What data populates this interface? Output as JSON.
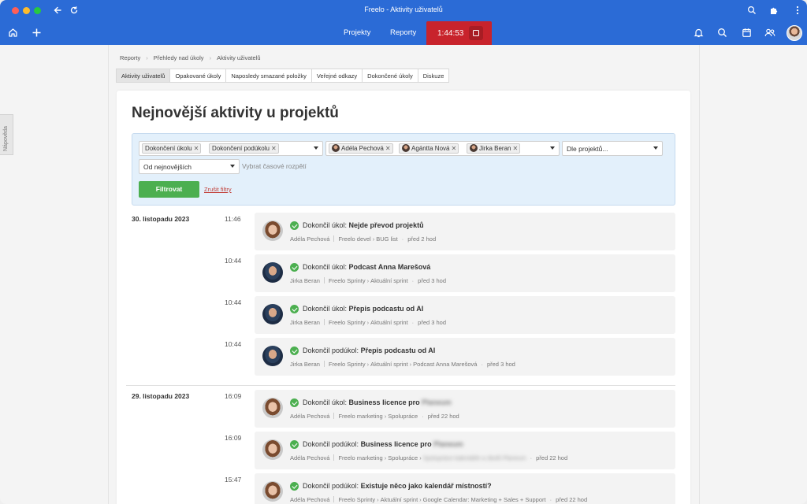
{
  "window": {
    "title": "Freelo - Aktivity uživatelů"
  },
  "icons": {
    "back": "arrow-left",
    "reload": "reload",
    "home": "home",
    "add": "plus",
    "zoom": "magnifier",
    "extensions": "puzzle",
    "menu": "kebab",
    "bell": "bell",
    "search": "magnifier",
    "calendar": "calendar",
    "users": "users"
  },
  "nav": {
    "projects": "Projekty",
    "reports": "Reporty"
  },
  "timer": {
    "time": "1:44:53"
  },
  "help": {
    "label": "Nápověda"
  },
  "breadcrumb": [
    "Reporty",
    "Přehledy nad úkoly",
    "Aktivity uživatelů"
  ],
  "subtabs": [
    {
      "label": "Aktivity uživatelů",
      "active": true
    },
    {
      "label": "Opakované úkoly",
      "active": false
    },
    {
      "label": "Naposledy smazané položky",
      "active": false
    },
    {
      "label": "Veřejné odkazy",
      "active": false
    },
    {
      "label": "Dokončené úkoly",
      "active": false
    },
    {
      "label": "Diskuze",
      "active": false
    }
  ],
  "page": {
    "title": "Nejnovější aktivity u projektů"
  },
  "filters": {
    "types": [
      "Dokončení úkolu",
      "Dokončení podúkolu"
    ],
    "users": [
      "Adéla Pechová",
      "Agántta Nová",
      "Jirka Beran"
    ],
    "projects_placeholder": "Dle projektů...",
    "sort": "Od nejnovějších",
    "date_placeholder": "Vybrat časové rozpětí",
    "submit": "Filtrovat",
    "reset": "Zrušit filtry"
  },
  "colors": {
    "topbar": "#2b6bd6",
    "timer": "#c8232c",
    "accent_green": "#4caf50",
    "filter_bg": "#e3f0fb"
  },
  "days": [
    {
      "date": "30. listopadu 2023",
      "items": [
        {
          "time": "11:46",
          "action": "Dokončil úkol:",
          "task": "Nejde převod projektů",
          "user": "Adéla Pechová",
          "project": "Freelo devel",
          "list": "BUG list",
          "ago": "před 2 hod"
        },
        {
          "time": "10:44",
          "action": "Dokončil úkol:",
          "task": "Podcast Anna Marešová",
          "user": "Jirka Beran",
          "project": "Freelo Sprinty",
          "list": "Aktuální sprint",
          "ago": "před 3 hod"
        },
        {
          "time": "10:44",
          "action": "Dokončil úkol:",
          "task": "Přepis podcastu od AI",
          "user": "Jirka Beran",
          "project": "Freelo Sprinty",
          "list": "Aktuální sprint",
          "ago": "před 3 hod"
        },
        {
          "time": "10:44",
          "action": "Dokončil podúkol:",
          "task": "Přepis podcastu od AI",
          "user": "Jirka Beran",
          "project": "Freelo Sprinty",
          "list": "Aktuální sprint",
          "parent": "Podcast Anna Marešová",
          "ago": "před 3 hod"
        }
      ]
    },
    {
      "date": "29. listopadu 2023",
      "items": [
        {
          "time": "16:09",
          "action": "Dokončil úkol:",
          "task": "Business licence pro",
          "task_hidden": "Planeum",
          "user": "Adéla Pechová",
          "project": "Freelo marketing",
          "list": "Spolupráce",
          "ago": "před 22 hod"
        },
        {
          "time": "16:09",
          "action": "Dokončil podúkol:",
          "task": "Business licence pro",
          "task_hidden": "Planeum",
          "user": "Adéla Pechová",
          "project": "Freelo marketing",
          "list": "Spolupráce",
          "parent_hidden": "Spolupráce kalendáře a úkolů Planeum",
          "ago": "před 22 hod"
        },
        {
          "time": "15:47",
          "action": "Dokončil podúkol:",
          "task": "Existuje něco jako kalendář místností?",
          "user": "Adéla Pechová",
          "project": "Freelo Sprinty",
          "list": "Aktuální sprint",
          "parent": "Google Calendar: Marketing + Sales + Support",
          "ago": "před 22 hod"
        }
      ]
    }
  ]
}
